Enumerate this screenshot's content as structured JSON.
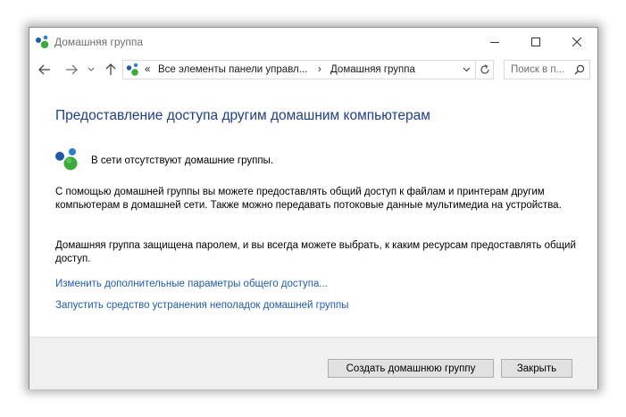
{
  "window": {
    "title": "Домашняя группа"
  },
  "navigation": {
    "breadcrumb_chevron": "«",
    "breadcrumb": [
      "Все элементы панели управл...",
      "Домашняя группа"
    ],
    "breadcrumb_separator": "›",
    "search_placeholder": "Поиск в п..."
  },
  "content": {
    "heading": "Предоставление доступа другим домашним компьютерам",
    "status_message": "В сети отсутствуют домашние группы.",
    "paragraph1": "С помощью домашней группы вы можете предоставлять общий доступ к файлам и принтерам другим компьютерам в домашней сети. Также можно передавать потоковые данные мультимедиа на устройства.",
    "paragraph2": "Домашняя группа защищена паролем, и вы всегда можете выбрать, к каким ресурсам предоставлять общий доступ.",
    "links": [
      "Изменить дополнительные параметры общего доступа...",
      "Запустить средство устранения неполадок домашней группы"
    ]
  },
  "buttons": {
    "create": "Создать домашнюю группу",
    "close": "Закрыть"
  },
  "colors": {
    "heading": "#1e3f8a",
    "link": "#1e5cb3",
    "footer_bg": "#f0f0f0"
  }
}
